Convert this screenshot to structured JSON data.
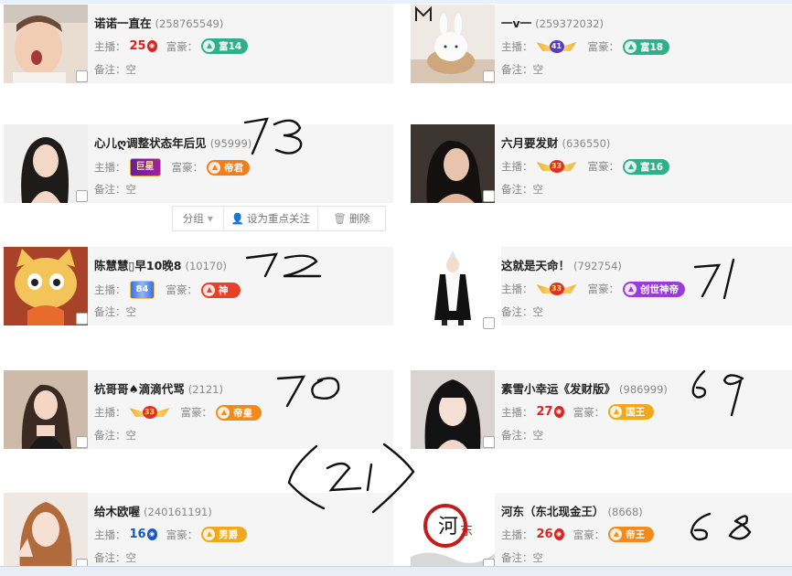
{
  "labels": {
    "host": "主播：",
    "rich": "富豪：",
    "note_prefix": "备注：",
    "note_value": "空"
  },
  "cards": [
    {
      "name": "诺诺一直在",
      "id": "(258765549)",
      "host_level": "25",
      "host_style": "num-red",
      "rich_badge": "富14",
      "rich_color": "#2fb08a"
    },
    {
      "name": "一v一",
      "id": "(259372032)",
      "host_level": "41",
      "host_style": "wing-blue",
      "rich_badge": "富18",
      "rich_color": "#2fb08a"
    },
    {
      "name": "心儿ღ调整状态年后见",
      "id": "(95999)",
      "host_level": "巨星",
      "host_style": "plaque",
      "rich_badge": "帝君",
      "rich_color": "#f07d1e"
    },
    {
      "name": "六月要发财",
      "id": "(636550)",
      "host_level": "33",
      "host_style": "wing",
      "rich_badge": "富16",
      "rich_color": "#2fb08a"
    },
    {
      "name": "陈慧慧▯早10晚8",
      "id": "(10170)",
      "host_level": "84",
      "host_style": "plaque-blue",
      "rich_badge": "神",
      "rich_color": "#e8412a"
    },
    {
      "name": "这就是天命！",
      "id": "(792754)",
      "host_level": "33",
      "host_style": "wing",
      "rich_badge": "创世神帝",
      "rich_color": "#9a3cd6"
    },
    {
      "name": "杭哥哥♠滴滴代骂",
      "id": "(2121)",
      "host_level": "33",
      "host_style": "wing",
      "rich_badge": "帝皇",
      "rich_color": "#f28a1c"
    },
    {
      "name": "素雪小幸运《发财版》",
      "id": "(986999)",
      "host_level": "27",
      "host_style": "num-red",
      "rich_badge": "国王",
      "rich_color": "#f2a81c"
    },
    {
      "name": "给木欧喔",
      "id": "(240161191)",
      "host_level": "16",
      "host_style": "num-blue",
      "rich_badge": "男爵",
      "rich_color": "#f2a81c"
    },
    {
      "name": "河东（东北现金王）",
      "id": "(8668)",
      "host_level": "26",
      "host_style": "num-red",
      "rich_badge": "帝王",
      "rich_color": "#f28a1c"
    }
  ],
  "toolbar": {
    "group": "分组",
    "focus": "设为重点关注",
    "delete": "删除"
  },
  "handwriting": {
    "n73": "73",
    "n72": "72",
    "n71": "71",
    "n70": "70",
    "n69": "69",
    "n68": "68",
    "n21": "⟨21⟩"
  }
}
